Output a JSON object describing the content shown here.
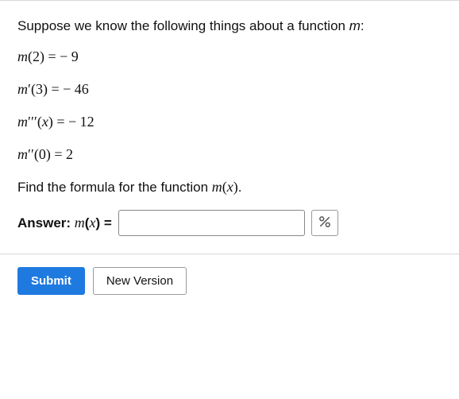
{
  "question": {
    "intro_pre": "Suppose we know the following things about a function ",
    "intro_fn": "m",
    "intro_post": ":",
    "equations": [
      {
        "lhs_fn": "m",
        "lhs_arg_pre": "(",
        "lhs_arg": "2",
        "lhs_arg_post": ")",
        "primes": "",
        "rhs": " − 9"
      },
      {
        "lhs_fn": "m",
        "lhs_arg_pre": "(",
        "lhs_arg": "3",
        "lhs_arg_post": ")",
        "primes": "′",
        "rhs": " − 46"
      },
      {
        "lhs_fn": "m",
        "lhs_arg_pre": "(",
        "lhs_arg": "x",
        "lhs_arg_post": ")",
        "primes": "′′′",
        "rhs": " − 12"
      },
      {
        "lhs_fn": "m",
        "lhs_arg_pre": "(",
        "lhs_arg": "0",
        "lhs_arg_post": ")",
        "primes": "′′",
        "rhs": "2"
      }
    ],
    "find_pre": "Find the formula for the function ",
    "find_fn": "m",
    "find_arg": "x",
    "find_post": "."
  },
  "answer": {
    "label_pre": "Answer: ",
    "label_fn": "m",
    "label_arg": "x",
    "eq_sign": " = ",
    "value": ""
  },
  "buttons": {
    "submit": "Submit",
    "new_version": "New Version"
  }
}
